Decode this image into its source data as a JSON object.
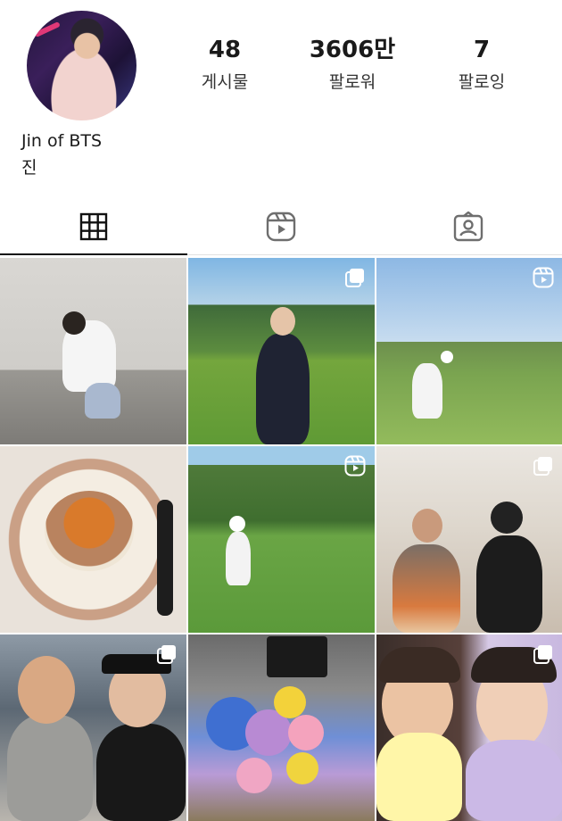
{
  "profile": {
    "display_name": "Jin of BTS",
    "bio": "진"
  },
  "stats": {
    "posts": {
      "value": "48",
      "label": "게시물"
    },
    "followers": {
      "value": "3606만",
      "label": "팔로워"
    },
    "following": {
      "value": "7",
      "label": "팔로잉"
    }
  },
  "tabs": [
    {
      "icon": "grid-icon",
      "active": true
    },
    {
      "icon": "reels-icon",
      "active": false
    },
    {
      "icon": "tagged-icon",
      "active": false
    }
  ],
  "posts": [
    {
      "badge": "none"
    },
    {
      "badge": "multi-photo-icon"
    },
    {
      "badge": "reels-icon"
    },
    {
      "badge": "none"
    },
    {
      "badge": "reels-icon"
    },
    {
      "badge": "multi-photo-icon"
    },
    {
      "badge": "multi-photo-icon"
    },
    {
      "badge": "none"
    },
    {
      "badge": "multi-photo-icon"
    }
  ],
  "colors": {
    "text": "#111111",
    "divider": "#e2e2e2",
    "icon": "#6e6e6e"
  }
}
